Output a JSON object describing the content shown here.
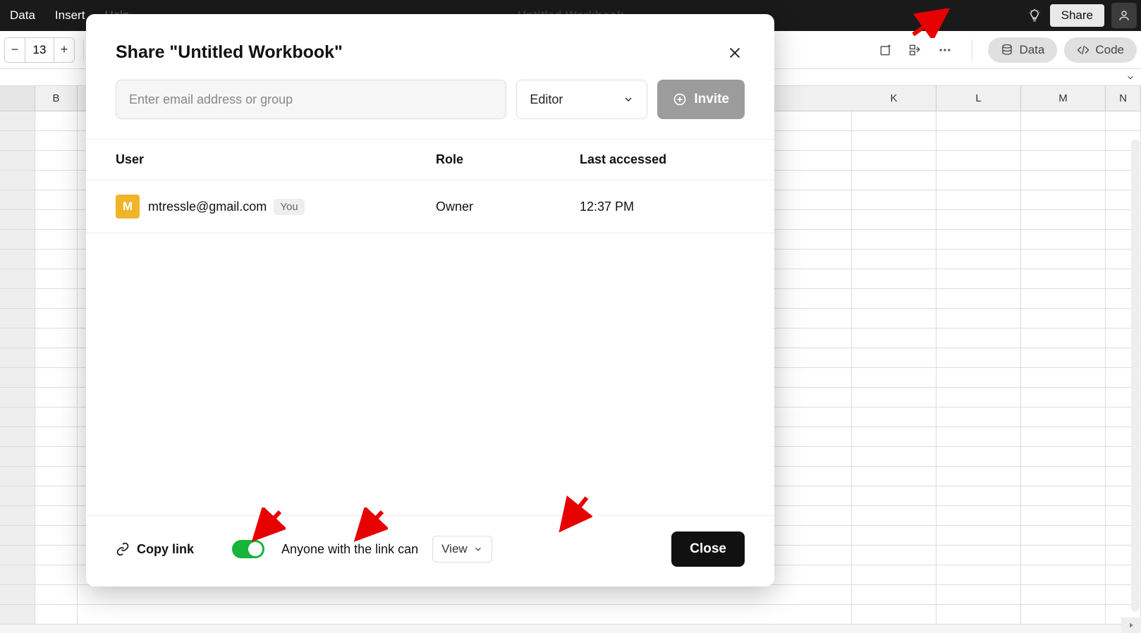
{
  "topbar": {
    "menu": [
      "Data",
      "Insert",
      "Help"
    ],
    "title": "Untitled Workbook",
    "share_label": "Share"
  },
  "toolbar": {
    "zoom_value": "13",
    "data_btn": "Data",
    "code_btn": "Code"
  },
  "columns": [
    "B",
    "K",
    "L",
    "M",
    "N"
  ],
  "modal": {
    "title": "Share \"Untitled Workbook\"",
    "email_placeholder": "Enter email address or group",
    "role_selected": "Editor",
    "invite_label": "Invite",
    "table_headers": {
      "user": "User",
      "role": "Role",
      "last": "Last accessed"
    },
    "users": [
      {
        "initial": "M",
        "email": "mtressle@gmail.com",
        "you_label": "You",
        "role": "Owner",
        "last": "12:37 PM"
      }
    ],
    "copy_link_label": "Copy link",
    "anyone_label": "Anyone with the link can",
    "link_perm_selected": "View",
    "close_label": "Close"
  }
}
